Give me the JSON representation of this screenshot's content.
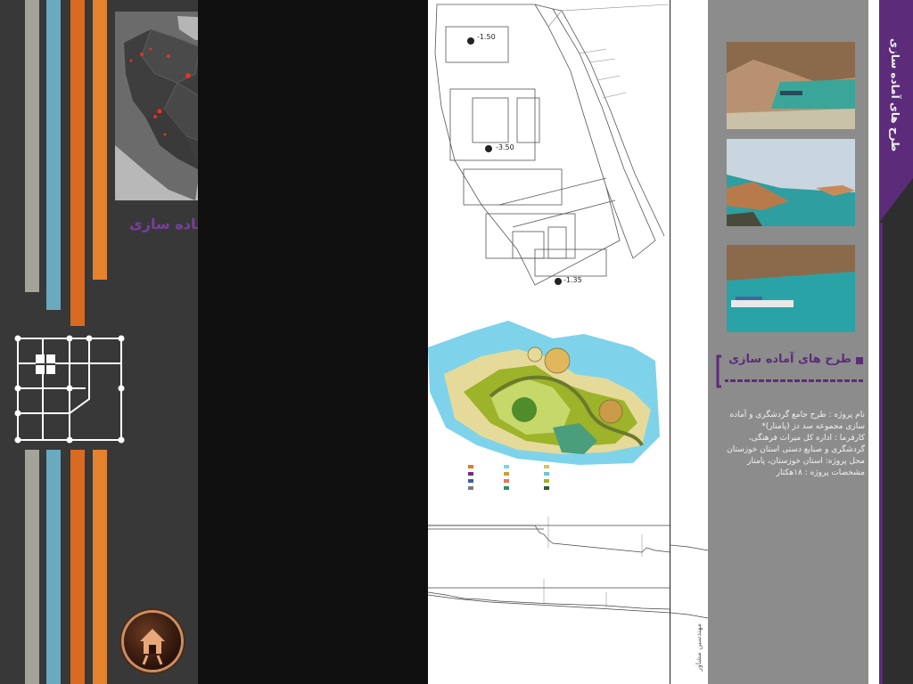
{
  "left": {
    "title": "طرح های آماده سازی",
    "stripe_colors": [
      "#a3a39a",
      "#6aaabf",
      "#d86b21",
      "#e5832c"
    ]
  },
  "plan": {
    "level_top": "-1.50",
    "level_mid": "-3.50",
    "level_bottom": "-1.35"
  },
  "info": {
    "heading": "طرح های آماده سازی",
    "project_name": "نام پروژه : طرح جامع گردشگری و آماده سازی مجموعه سد دز (پامنار)*",
    "client": "کارفرما : اداره کل میراث فرهنگی، گردشگری و صنایع دستی استان خوزستان",
    "location": "محل پروژه: استان خوزستان، پامنار",
    "specs": "مشخصات پروژه : ۱۸هکتار"
  },
  "edge": {
    "title": "طرح های آماده سازی"
  },
  "credit": "مهندسین مشاور",
  "icons": {
    "home": "home-icon",
    "grid": "grid-logo-icon"
  }
}
